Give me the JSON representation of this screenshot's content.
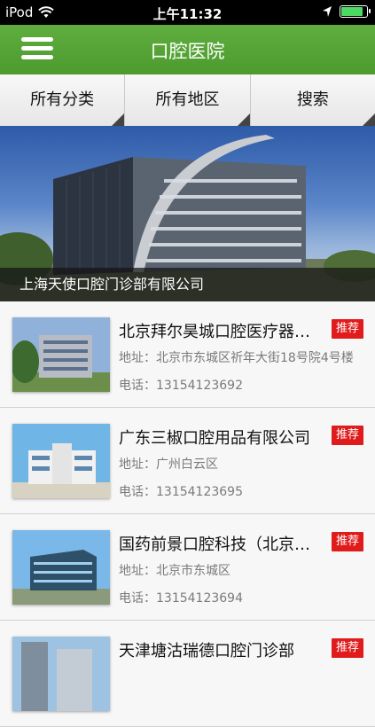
{
  "status_bar": {
    "carrier": "iPod",
    "time": "上午11:32",
    "wifi_icon": "wifi-icon",
    "location_icon": "location-arrow-icon",
    "battery_icon": "battery-icon",
    "battery_level": 0.9
  },
  "navbar": {
    "title": "口腔医院",
    "menu_icon": "hamburger-menu-icon",
    "color": "#55a535"
  },
  "filters": [
    {
      "label": "所有分类"
    },
    {
      "label": "所有地区"
    },
    {
      "label": "搜索"
    }
  ],
  "banner": {
    "caption": "上海天使口腔门诊部有限公司"
  },
  "items": [
    {
      "title": "北京拜尔昊城口腔医疗器械有限公司",
      "address": "地址：北京市东城区祈年大街18号院4号楼",
      "phone": "电话：13154123692",
      "badge": "推荐"
    },
    {
      "title": " 广东三椒口腔用品有限公司",
      "address": "地址：广州白云区",
      "phone": "电话：13154123695",
      "badge": "推荐"
    },
    {
      "title": " 国药前景口腔科技（北京）有限公司",
      "address": "地址：北京市东城区",
      "phone": "电话：13154123694",
      "badge": "推荐"
    },
    {
      "title": "天津塘沽瑞德口腔门诊部",
      "address": "",
      "phone": "",
      "badge": "推荐"
    }
  ],
  "colors": {
    "accent": "#55a535",
    "badge": "#e01b1b"
  }
}
